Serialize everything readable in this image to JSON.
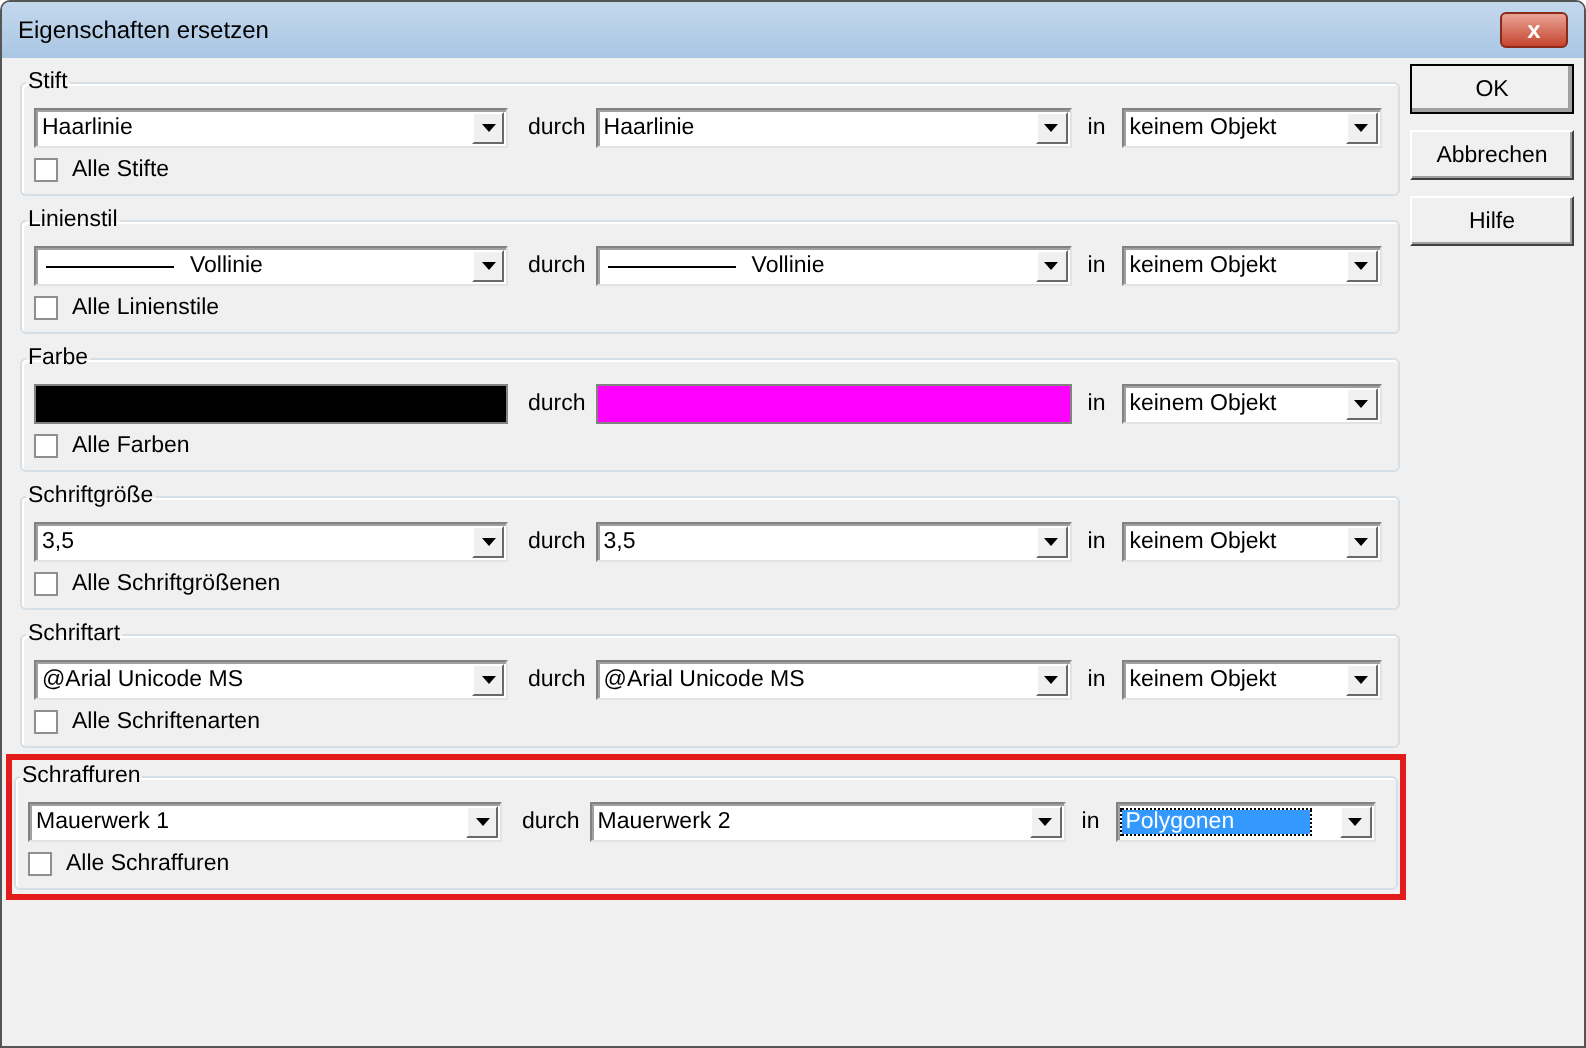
{
  "window": {
    "title": "Eigenschaften ersetzen",
    "close_symbol": "x"
  },
  "sections": [
    {
      "label": "Stift",
      "highlighted": false,
      "from": {
        "kind": "text",
        "value": "Haarlinie"
      },
      "to": {
        "kind": "text",
        "value": "Haarlinie"
      },
      "connector": "durch",
      "in_label": "in",
      "target": {
        "value": "keinem Objekt",
        "selected": false
      },
      "all": {
        "label": "Alle Stifte",
        "checked": false
      }
    },
    {
      "label": "Linienstil",
      "highlighted": false,
      "from": {
        "kind": "line",
        "value": "Vollinie"
      },
      "to": {
        "kind": "line",
        "value": "Vollinie"
      },
      "connector": "durch",
      "in_label": "in",
      "target": {
        "value": "keinem Objekt",
        "selected": false
      },
      "all": {
        "label": "Alle Linienstile",
        "checked": false
      }
    },
    {
      "label": "Farbe",
      "highlighted": false,
      "from": {
        "kind": "color",
        "color": "#000000"
      },
      "to": {
        "kind": "color",
        "color": "#ff00ff"
      },
      "connector": "durch",
      "in_label": "in",
      "target": {
        "value": "keinem Objekt",
        "selected": false
      },
      "all": {
        "label": "Alle Farben",
        "checked": false
      }
    },
    {
      "label": "Schriftgröße",
      "highlighted": false,
      "from": {
        "kind": "text",
        "value": "3,5"
      },
      "to": {
        "kind": "text",
        "value": "3,5"
      },
      "connector": "durch",
      "in_label": "in",
      "target": {
        "value": "keinem Objekt",
        "selected": false
      },
      "all": {
        "label": "Alle Schriftgrößenen",
        "checked": false
      }
    },
    {
      "label": "Schriftart",
      "highlighted": false,
      "from": {
        "kind": "text",
        "value": "@Arial Unicode MS"
      },
      "to": {
        "kind": "text",
        "value": "@Arial Unicode MS"
      },
      "connector": "durch",
      "in_label": "in",
      "target": {
        "value": "keinem Objekt",
        "selected": false
      },
      "all": {
        "label": "Alle Schriftenarten",
        "checked": false
      }
    },
    {
      "label": "Schraffuren",
      "highlighted": true,
      "from": {
        "kind": "text",
        "value": "Mauerwerk 1"
      },
      "to": {
        "kind": "text",
        "value": "Mauerwerk 2"
      },
      "connector": "durch",
      "in_label": "in",
      "target": {
        "value": "Polygonen",
        "selected": true
      },
      "all": {
        "label": "Alle Schraffuren",
        "checked": false
      }
    }
  ],
  "buttons": [
    {
      "label": "OK"
    },
    {
      "label": "Abbrechen"
    },
    {
      "label": "Hilfe"
    }
  ]
}
